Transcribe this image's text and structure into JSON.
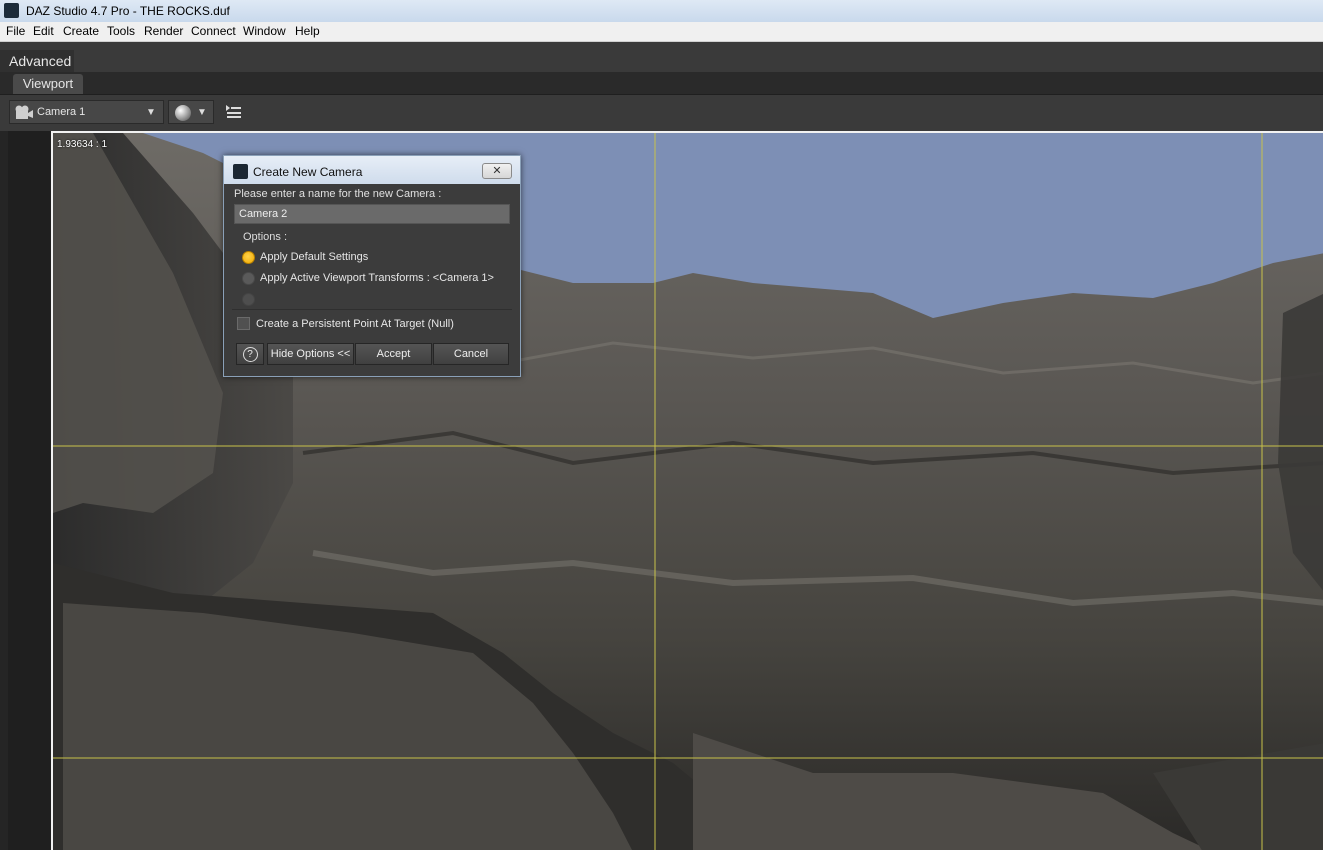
{
  "window": {
    "title": "DAZ Studio 4.7 Pro - THE ROCKS.duf"
  },
  "menu": [
    "File",
    "Edit",
    "Create",
    "Tools",
    "Render",
    "Connect",
    "Window",
    "Help"
  ],
  "activity_tab": "Advanced",
  "pane_tab": "Viewport",
  "toolbar": {
    "camera": "Camera 1"
  },
  "viewport": {
    "aspect_ratio": "1.93634 : 1"
  },
  "dialog": {
    "title": "Create New Camera",
    "prompt": "Please enter a name for the new Camera :",
    "name_value": "Camera 2",
    "options_label": "Options :",
    "radio_options": [
      {
        "label": "Apply Default Settings",
        "selected": true
      },
      {
        "label": "Apply Active Viewport Transforms : <Camera 1>",
        "selected": false
      },
      {
        "label": "",
        "selected": false
      }
    ],
    "checkbox": {
      "label": "Create a Persistent Point At Target (Null)",
      "checked": false
    },
    "buttons": {
      "help": "?",
      "hide_options": "Hide Options <<",
      "accept": "Accept",
      "cancel": "Cancel"
    }
  },
  "colors": {
    "sky": "#7d8fb5",
    "guide_lines": "#c8c24a",
    "selected_radio": "#f5b400"
  }
}
